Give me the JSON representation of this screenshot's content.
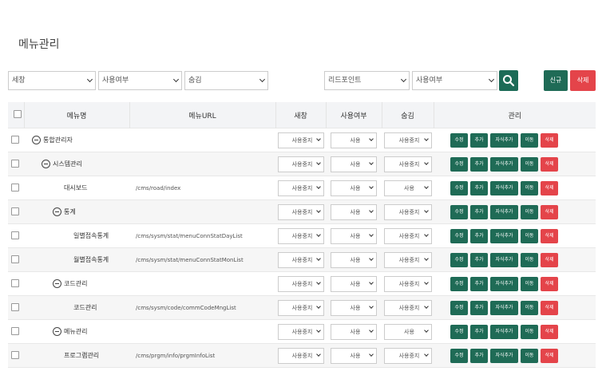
{
  "page_title": "메뉴관리",
  "filters": {
    "f1": "세창",
    "f2": "사용여부",
    "f3": "숨김",
    "f4": "리드포인트",
    "f5": "사용여부"
  },
  "buttons": {
    "new": "신규",
    "delete": "삭제"
  },
  "columns": {
    "name": "메뉴명",
    "url": "메뉴URL",
    "window": "새창",
    "use": "사용여부",
    "hidden": "숨김",
    "manage": "관리"
  },
  "actions": {
    "edit": "수정",
    "add": "추가",
    "add_child": "자식추가",
    "move": "이동",
    "delete": "삭제"
  },
  "rows": [
    {
      "name": "통합관리자",
      "url": "",
      "window": "사용중지",
      "use": "사용",
      "hidden": "사용중지"
    },
    {
      "name": "시스템관리",
      "url": "",
      "window": "사용중지",
      "use": "사용",
      "hidden": "사용중지"
    },
    {
      "name": "대시보드",
      "url": "/cms/road/index",
      "window": "사용중지",
      "use": "사용",
      "hidden": "사용"
    },
    {
      "name": "통계",
      "url": "",
      "window": "사용중지",
      "use": "사용",
      "hidden": "사용중지"
    },
    {
      "name": "일별접속통계",
      "url": "/cms/sysm/stat/menuConnStatDayList",
      "window": "사용중지",
      "use": "사용",
      "hidden": "사용중지"
    },
    {
      "name": "월별접속통계",
      "url": "/cms/sysm/stat/menuConnStatMonList",
      "window": "사용중지",
      "use": "사용",
      "hidden": "사용중지"
    },
    {
      "name": "코드관리",
      "url": "",
      "window": "사용중지",
      "use": "사용",
      "hidden": "사용중지"
    },
    {
      "name": "코드관리",
      "url": "/cms/sysm/code/commCodeMngList",
      "window": "사용중지",
      "use": "사용",
      "hidden": "사용중지"
    },
    {
      "name": "메뉴관리",
      "url": "",
      "window": "사용중지",
      "use": "사용",
      "hidden": "사용"
    },
    {
      "name": "프로그램관리",
      "url": "/cms/prgm/info/prgmInfoList",
      "window": "사용중지",
      "use": "사용",
      "hidden": "사용중지"
    }
  ],
  "colors": {
    "green": "#1f6b56",
    "red": "#e4444a"
  }
}
